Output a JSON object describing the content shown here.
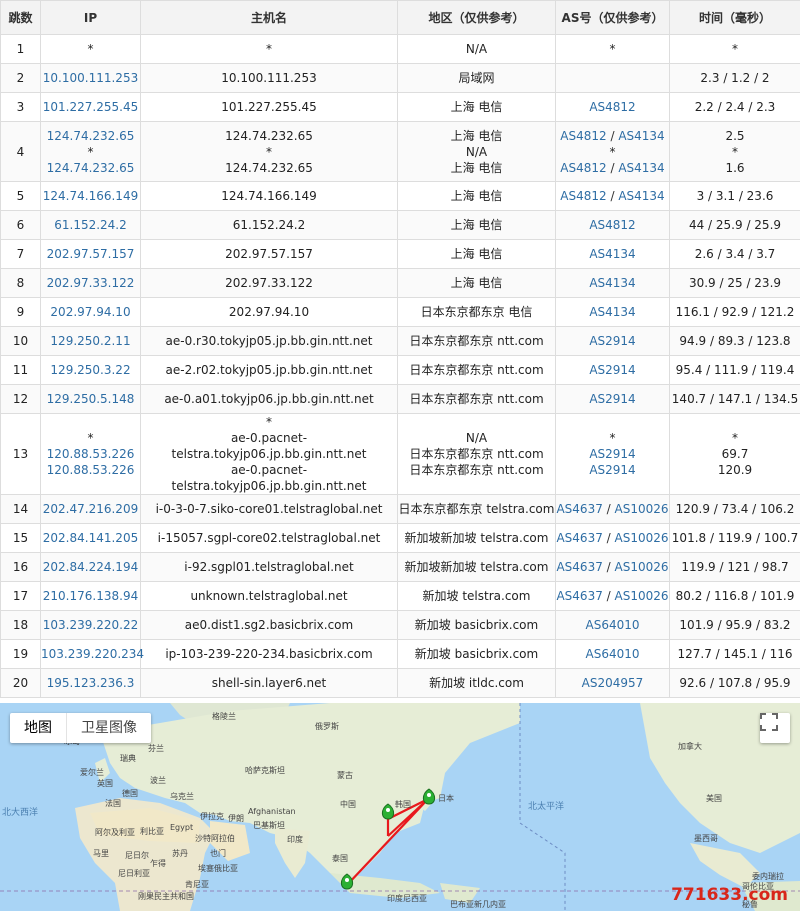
{
  "table": {
    "headers": [
      "跳数",
      "IP",
      "主机名",
      "地区（仅供参考）",
      "AS号（仅供参考）",
      "时间（毫秒）"
    ],
    "rows": [
      {
        "hop": "1",
        "ip": [
          "*"
        ],
        "host": [
          "*"
        ],
        "region": [
          "N/A"
        ],
        "as": [
          [
            {
              "t": "*",
              "link": false
            }
          ]
        ],
        "time": [
          "*"
        ]
      },
      {
        "hop": "2",
        "ip": [
          "10.100.111.253"
        ],
        "host": [
          "10.100.111.253"
        ],
        "region": [
          "局域网"
        ],
        "as": [
          []
        ],
        "time": [
          "2.3 / 1.2 / 2"
        ]
      },
      {
        "hop": "3",
        "ip": [
          "101.227.255.45"
        ],
        "host": [
          "101.227.255.45"
        ],
        "region": [
          "上海 电信"
        ],
        "as": [
          [
            {
              "t": "AS4812",
              "link": true
            }
          ]
        ],
        "time": [
          "2.2 / 2.4 / 2.3"
        ]
      },
      {
        "hop": "4",
        "ip": [
          "124.74.232.65",
          "*",
          "124.74.232.65"
        ],
        "host": [
          "124.74.232.65",
          "*",
          "124.74.232.65"
        ],
        "region": [
          "上海 电信",
          "N/A",
          "上海 电信"
        ],
        "as": [
          [
            {
              "t": "AS4812",
              "link": true
            },
            {
              "t": "AS4134",
              "link": true
            }
          ],
          [
            {
              "t": "*",
              "link": false
            }
          ],
          [
            {
              "t": "AS4812",
              "link": true
            },
            {
              "t": "AS4134",
              "link": true
            }
          ]
        ],
        "time": [
          "2.5",
          "*",
          "1.6"
        ]
      },
      {
        "hop": "5",
        "ip": [
          "124.74.166.149"
        ],
        "host": [
          "124.74.166.149"
        ],
        "region": [
          "上海 电信"
        ],
        "as": [
          [
            {
              "t": "AS4812",
              "link": true
            },
            {
              "t": "AS4134",
              "link": true
            }
          ]
        ],
        "time": [
          "3 / 3.1 / 23.6"
        ]
      },
      {
        "hop": "6",
        "ip": [
          "61.152.24.2"
        ],
        "host": [
          "61.152.24.2"
        ],
        "region": [
          "上海 电信"
        ],
        "as": [
          [
            {
              "t": "AS4812",
              "link": true
            }
          ]
        ],
        "time": [
          "44 / 25.9 / 25.9"
        ]
      },
      {
        "hop": "7",
        "ip": [
          "202.97.57.157"
        ],
        "host": [
          "202.97.57.157"
        ],
        "region": [
          "上海 电信"
        ],
        "as": [
          [
            {
              "t": "AS4134",
              "link": true
            }
          ]
        ],
        "time": [
          "2.6 / 3.4 / 3.7"
        ]
      },
      {
        "hop": "8",
        "ip": [
          "202.97.33.122"
        ],
        "host": [
          "202.97.33.122"
        ],
        "region": [
          "上海 电信"
        ],
        "as": [
          [
            {
              "t": "AS4134",
              "link": true
            }
          ]
        ],
        "time": [
          "30.9 / 25 / 23.9"
        ]
      },
      {
        "hop": "9",
        "ip": [
          "202.97.94.10"
        ],
        "host": [
          "202.97.94.10"
        ],
        "region": [
          "日本东京都东京 电信"
        ],
        "as": [
          [
            {
              "t": "AS4134",
              "link": true
            }
          ]
        ],
        "time": [
          "116.1 / 92.9 / 121.2"
        ]
      },
      {
        "hop": "10",
        "ip": [
          "129.250.2.11"
        ],
        "host": [
          "ae-0.r30.tokyjp05.jp.bb.gin.ntt.net"
        ],
        "region": [
          "日本东京都东京 ntt.com"
        ],
        "as": [
          [
            {
              "t": "AS2914",
              "link": true
            }
          ]
        ],
        "time": [
          "94.9 / 89.3 / 123.8"
        ]
      },
      {
        "hop": "11",
        "ip": [
          "129.250.3.22"
        ],
        "host": [
          "ae-2.r02.tokyjp05.jp.bb.gin.ntt.net"
        ],
        "region": [
          "日本东京都东京 ntt.com"
        ],
        "as": [
          [
            {
              "t": "AS2914",
              "link": true
            }
          ]
        ],
        "time": [
          "95.4 / 111.9 / 119.4"
        ]
      },
      {
        "hop": "12",
        "ip": [
          "129.250.5.148"
        ],
        "host": [
          "ae-0.a01.tokyjp06.jp.bb.gin.ntt.net"
        ],
        "region": [
          "日本东京都东京 ntt.com"
        ],
        "as": [
          [
            {
              "t": "AS2914",
              "link": true
            }
          ]
        ],
        "time": [
          "140.7 / 147.1 / 134.5"
        ]
      },
      {
        "hop": "13",
        "ip": [
          "*",
          "120.88.53.226",
          "120.88.53.226"
        ],
        "host": [
          "*",
          "ae-0.pacnet-telstra.tokyjp06.jp.bb.gin.ntt.net",
          "ae-0.pacnet-telstra.tokyjp06.jp.bb.gin.ntt.net"
        ],
        "region": [
          "N/A",
          "日本东京都东京 ntt.com",
          "日本东京都东京 ntt.com"
        ],
        "as": [
          [
            {
              "t": "*",
              "link": false
            }
          ],
          [
            {
              "t": "AS2914",
              "link": true
            }
          ],
          [
            {
              "t": "AS2914",
              "link": true
            }
          ]
        ],
        "time": [
          "*",
          "69.7",
          "120.9"
        ]
      },
      {
        "hop": "14",
        "ip": [
          "202.47.216.209"
        ],
        "host": [
          "i-0-3-0-7.siko-core01.telstraglobal.net"
        ],
        "region": [
          "日本东京都东京 telstra.com"
        ],
        "as": [
          [
            {
              "t": "AS4637",
              "link": true
            },
            {
              "t": "AS10026",
              "link": true
            }
          ]
        ],
        "time": [
          "120.9 / 73.4 / 106.2"
        ]
      },
      {
        "hop": "15",
        "ip": [
          "202.84.141.205"
        ],
        "host": [
          "i-15057.sgpl-core02.telstraglobal.net"
        ],
        "region": [
          "新加坡新加坡 telstra.com"
        ],
        "as": [
          [
            {
              "t": "AS4637",
              "link": true
            },
            {
              "t": "AS10026",
              "link": true
            }
          ]
        ],
        "time": [
          "101.8 / 119.9 / 100.7"
        ]
      },
      {
        "hop": "16",
        "ip": [
          "202.84.224.194"
        ],
        "host": [
          "i-92.sgpl01.telstraglobal.net"
        ],
        "region": [
          "新加坡新加坡 telstra.com"
        ],
        "as": [
          [
            {
              "t": "AS4637",
              "link": true
            },
            {
              "t": "AS10026",
              "link": true
            }
          ]
        ],
        "time": [
          "119.9 / 121 / 98.7"
        ]
      },
      {
        "hop": "17",
        "ip": [
          "210.176.138.94"
        ],
        "host": [
          "unknown.telstraglobal.net"
        ],
        "region": [
          "新加坡 telstra.com"
        ],
        "as": [
          [
            {
              "t": "AS4637",
              "link": true
            },
            {
              "t": "AS10026",
              "link": true
            }
          ]
        ],
        "time": [
          "80.2 / 116.8 / 101.9"
        ]
      },
      {
        "hop": "18",
        "ip": [
          "103.239.220.22"
        ],
        "host": [
          "ae0.dist1.sg2.basicbrix.com"
        ],
        "region": [
          "新加坡 basicbrix.com"
        ],
        "as": [
          [
            {
              "t": "AS64010",
              "link": true
            }
          ]
        ],
        "time": [
          "101.9 / 95.9 / 83.2"
        ]
      },
      {
        "hop": "19",
        "ip": [
          "103.239.220.234"
        ],
        "host": [
          "ip-103-239-220-234.basicbrix.com"
        ],
        "region": [
          "新加坡 basicbrix.com"
        ],
        "as": [
          [
            {
              "t": "AS64010",
              "link": true
            }
          ]
        ],
        "time": [
          "127.7 / 145.1 / 116"
        ]
      },
      {
        "hop": "20",
        "ip": [
          "195.123.236.3"
        ],
        "host": [
          "shell-sin.layer6.net"
        ],
        "region": [
          "新加坡 itldc.com"
        ],
        "as": [
          [
            {
              "t": "AS204957",
              "link": true
            }
          ]
        ],
        "time": [
          "92.6 / 107.8 / 95.9"
        ]
      }
    ]
  },
  "map": {
    "type_buttons": [
      "地图",
      "卫星图像"
    ],
    "fullscreen_icon": "fullscreen-icon",
    "labels": {
      "north_atlantic": "北大西洋",
      "north_pacific": "北太平洋",
      "greenland": "格陵兰",
      "russia": "俄罗斯",
      "finland": "芬兰",
      "sweden": "瑞典",
      "uk": "英国",
      "ireland": "爱尔兰",
      "germany": "德国",
      "france": "法国",
      "poland": "波兰",
      "ukraine": "乌克兰",
      "kazakhstan": "哈萨克斯坦",
      "mongolia": "蒙古",
      "china": "中国",
      "korea": "韩国",
      "japan": "日本",
      "afghanistan": "Afghanistan",
      "iran": "伊朗",
      "iraq": "伊拉克",
      "pakistan": "巴基斯坦",
      "india": "印度",
      "saudi": "沙特阿拉伯",
      "egypt": "Egypt",
      "algeria": "阿尔及利亚",
      "libya": "利比亚",
      "mali": "马里",
      "niger": "尼日尔",
      "chad": "乍得",
      "sudan": "苏丹",
      "ethiopia": "埃塞俄比亚",
      "nigeria": "尼日利亚",
      "kenya": "肯尼亚",
      "drc": "刚果民主共和国",
      "indonesia": "印度尼西亚",
      "png": "巴布亚新几内亚",
      "canada": "加拿大",
      "usa": "美国",
      "mexico": "墨西哥",
      "venezuela": "委内瑞拉",
      "colombia": "哥伦比亚",
      "peru": "秘鲁",
      "iceland": "冰岛",
      "yemen": "也门",
      "thailand": "泰国"
    },
    "route_color": "#e8191d",
    "marker_color": "#2bb033"
  },
  "watermark": "771633.com"
}
